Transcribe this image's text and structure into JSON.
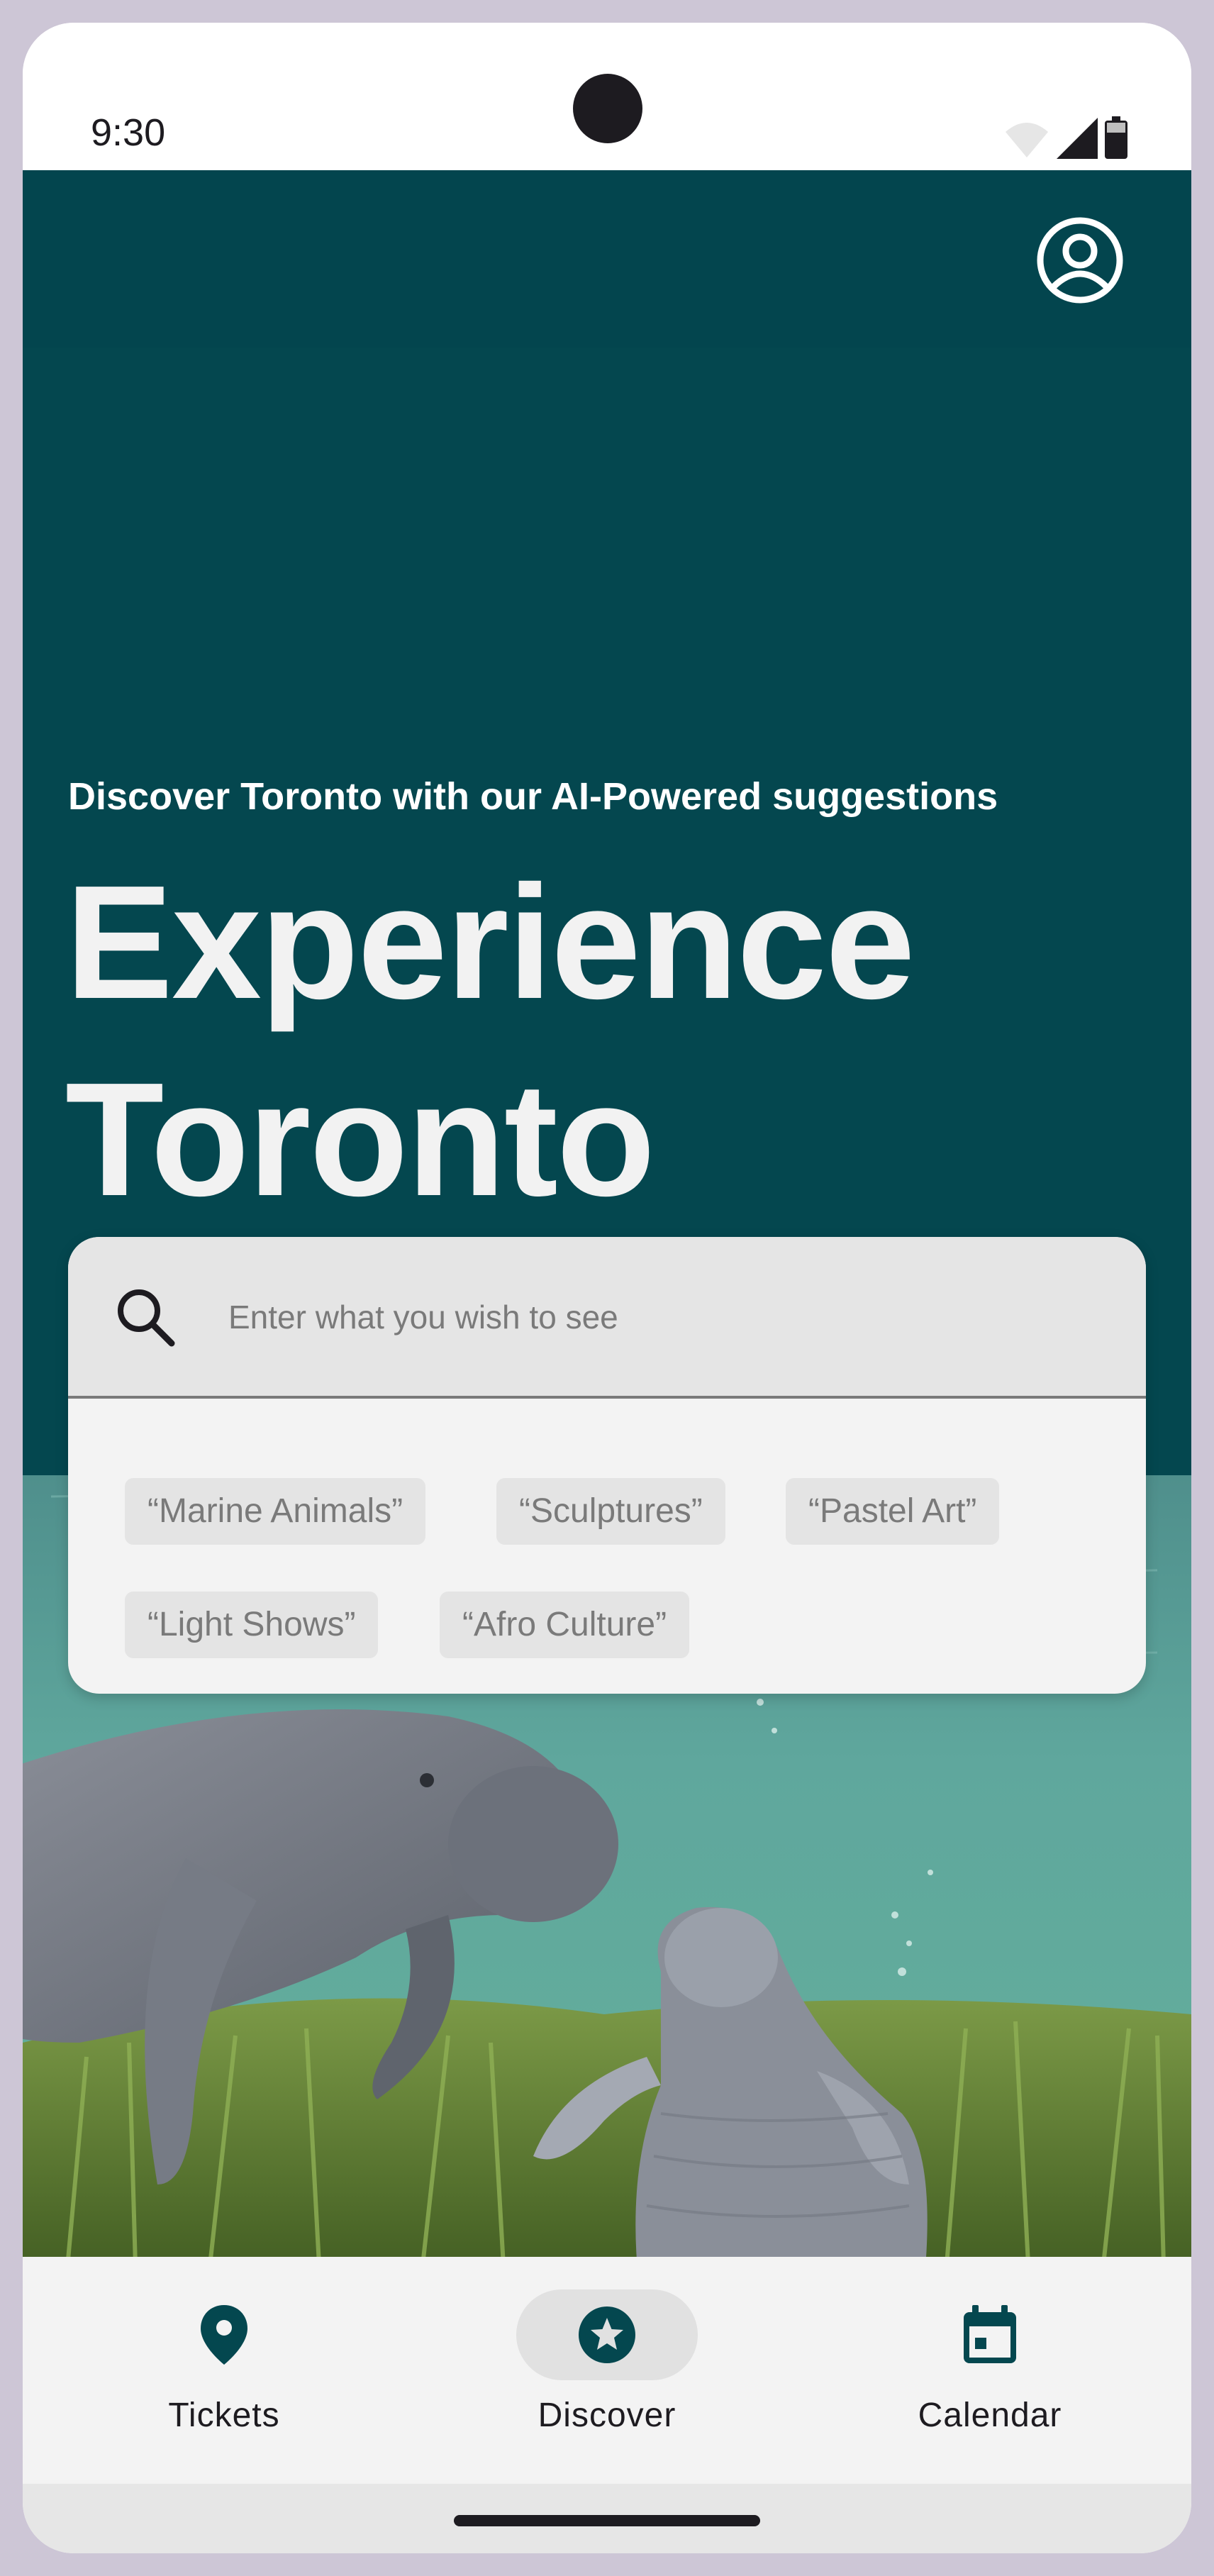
{
  "status_bar": {
    "time": "9:30",
    "icons": [
      "wifi-icon",
      "cell-signal-icon",
      "battery-icon"
    ]
  },
  "header": {
    "account_icon": "account-circle-icon"
  },
  "hero": {
    "subtitle": "Discover Toronto with our AI-Powered suggestions",
    "title_line1": "Experience",
    "title_line2": "Toronto",
    "background_color": "#04474f",
    "image_subject": "Manatees swimming over seagrass"
  },
  "search": {
    "placeholder": "Enter what you wish to see",
    "value": "",
    "suggestions": [
      "“Marine Animals”",
      "“Sculptures”",
      "“Pastel Art”",
      "“Light Shows”",
      "“Afro Culture”"
    ]
  },
  "bottom_nav": {
    "items": [
      {
        "label": "Tickets",
        "icon": "location-pin-icon",
        "active": false
      },
      {
        "label": "Discover",
        "icon": "star-circle-icon",
        "active": true
      },
      {
        "label": "Calendar",
        "icon": "calendar-icon",
        "active": false
      }
    ]
  },
  "colors": {
    "primary": "#04474f",
    "surface": "#f3f3f3",
    "on_surface": "#1d1b20"
  }
}
